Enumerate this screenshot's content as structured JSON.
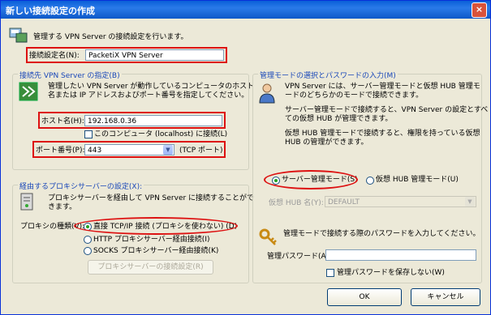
{
  "window": {
    "title": "新しい接続設定の作成",
    "close_label": "×"
  },
  "intro": {
    "text": "管理する VPN Server の接続設定を行います。"
  },
  "connection_name": {
    "label": "接続設定名(N):",
    "value": "PacketiX VPN Server"
  },
  "dest": {
    "title": "接続先 VPN Server の指定(B)",
    "desc1": "管理したい VPN Server が動作しているコンピュータのホスト",
    "desc2": "名または IP アドレスおよびポート番号を指定してください。",
    "host_label": "ホスト名(H):",
    "host_value": "192.168.0.36",
    "localhost_label": "このコンピュータ (localhost) に接続(L)",
    "port_label": "ポート番号(P):",
    "port_value": "443",
    "port_suffix": "(TCP ポート)"
  },
  "proxy": {
    "title": "経由するプロキシサーバーの設定(X):",
    "desc1": "プロキシサーバーを経由して VPN Server に接続することがで",
    "desc2": "きます。",
    "type_label": "プロキシの種類(V):",
    "opt_direct": "直接 TCP/IP 接続 (プロキシを使わない) (D)",
    "opt_http": "HTTP プロキシサーバー経由接続(I)",
    "opt_socks": "SOCKS プロキシサーバー経由接続(K)",
    "settings_button": "プロキシサーバーの接続設定(R)"
  },
  "mode": {
    "title": "管理モードの選択とパスワードの入力(M)",
    "p1a": "VPN Server には、サーバー管理モードと仮想 HUB 管理モ",
    "p1b": "ードのどちらかのモードで接続できます。",
    "p2a": "サーバー管理モードで接続すると、VPN Server の設定とすべ",
    "p2b": "ての仮想 HUB が管理できます。",
    "p3a": "仮想 HUB 管理モードで接続すると、権限を持っている仮想",
    "p3b": "HUB の管理ができます。",
    "opt_server": "サーバー管理モード(S)",
    "opt_hub": "仮想 HUB 管理モード(U)",
    "hub_label": "仮想 HUB 名(Y):",
    "hub_value": "DEFAULT",
    "pw_intro": "管理モードで接続する際のパスワードを入力してください。",
    "pw_label": "管理パスワード(A):",
    "pw_value": "",
    "save_pw_label": "管理パスワードを保存しない(W)"
  },
  "buttons": {
    "ok": "OK",
    "cancel": "キャンセル"
  }
}
